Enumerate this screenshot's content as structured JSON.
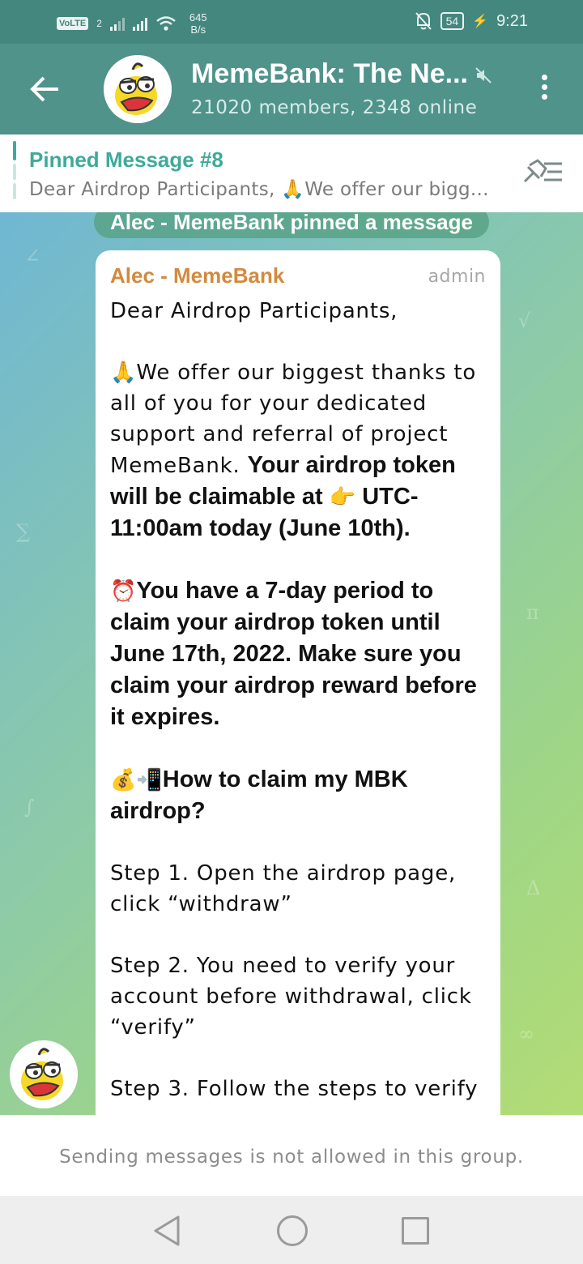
{
  "status_bar": {
    "volte": "VoLTE",
    "sim_number": "2",
    "net_speed_value": "645",
    "net_speed_unit": "B/s",
    "battery": "54",
    "time": "9:21"
  },
  "header": {
    "title": "MemeBank: The Ne...",
    "subtitle": "21020 members, 2348 online",
    "icons": {
      "back": "arrow-left-icon",
      "mute": "muted-speaker-icon",
      "menu": "more-vertical-icon"
    }
  },
  "pinned": {
    "title": "Pinned Message #8",
    "preview": "Dear Airdrop Participants,  🙏We offer our bigg..."
  },
  "service_message": "Alec - MemeBank pinned a message",
  "message": {
    "sender": "Alec - MemeBank",
    "role": "admin",
    "greeting": "Dear Airdrop Participants,",
    "p1_emoji": "🙏",
    "p1_text": "We offer our biggest thanks to all of you for your dedicated support and referral of project MemeBank. ",
    "p1_bold": "Your airdrop token will be claimable at ",
    "p1_bold_emoji": "👉",
    "p1_bold_end": " UTC-11:00am today (June 10th).",
    "p2_emoji": "⏰",
    "p2_bold": "You have a 7-day period to claim your airdrop token until June 17th, 2022. Make sure you claim your airdrop reward before it expires.",
    "p3_emoji": "💰📲",
    "p3_bold": "How to claim my MBK airdrop?",
    "step1": "Step 1. Open the airdrop page, click “withdraw”",
    "step2": "Step 2. You need to verify your account before withdrawal, click “verify”",
    "step3": "Step 3. Follow the steps to verify"
  },
  "footer_notice": "Sending messages is not allowed in this group.",
  "colors": {
    "header": "#4f938b",
    "status_bar": "#44877f",
    "accent": "#3eaa9a",
    "sender": "#d38a3d"
  }
}
